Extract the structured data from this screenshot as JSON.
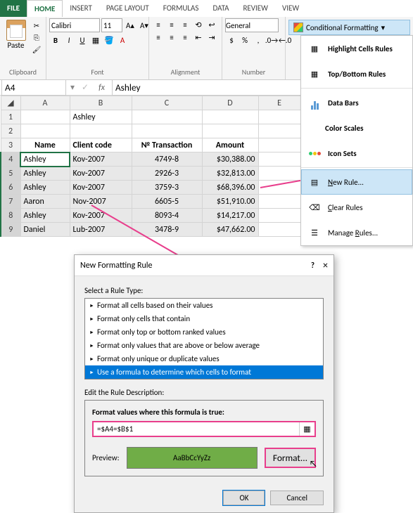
{
  "tabs": {
    "file": "FILE",
    "home": "HOME",
    "insert": "INSERT",
    "page_layout": "PAGE LAYOUT",
    "formulas": "FORMULAS",
    "data": "DATA",
    "review": "REVIEW",
    "view": "VIEW"
  },
  "ribbon": {
    "clipboard": {
      "paste": "Paste",
      "label": "Clipboard"
    },
    "font": {
      "name": "Calibri",
      "size": "11",
      "label": "Font",
      "bold": "B",
      "italic": "I",
      "underline": "U"
    },
    "alignment": {
      "label": "Alignment"
    },
    "number": {
      "format": "General",
      "label": "Number",
      "currency": "$",
      "percent": "%",
      "comma": ","
    },
    "cf_label": "Conditional Formatting"
  },
  "cf_menu": {
    "highlight": "Highlight Cells Rules",
    "topbottom": "Top/Bottom Rules",
    "databars": "Data Bars",
    "colorscales": "Color Scales",
    "iconsets": "Icon Sets",
    "newrule": "New Rule...",
    "clear": "Clear Rules",
    "manage": "Manage Rules...",
    "new_accel": "N",
    "clear_accel": "C",
    "manage_accel": "R"
  },
  "namebox": "A4",
  "fx": "fx",
  "formula_value": "Ashley",
  "columns": [
    "A",
    "B",
    "C",
    "D",
    "E"
  ],
  "row1": {
    "b": "Ashley"
  },
  "headers": {
    "a": "Name",
    "b": "Client code",
    "c": "№ Transaction",
    "d": "Amount"
  },
  "rows": [
    {
      "n": "4",
      "a": "Ashley",
      "b": "Kov-2007",
      "c": "4749-8",
      "d": "$30,388.00"
    },
    {
      "n": "5",
      "a": "Ashley",
      "b": "Kov-2007",
      "c": "2926-3",
      "d": "$32,813.00"
    },
    {
      "n": "6",
      "a": "Ashley",
      "b": "Kov-2007",
      "c": "3759-3",
      "d": "$68,396.00"
    },
    {
      "n": "7",
      "a": "Aaron",
      "b": "Nov-2007",
      "c": "6605-5",
      "d": "$51,910.00"
    },
    {
      "n": "8",
      "a": "Ashley",
      "b": "Kov-2007",
      "c": "8093-4",
      "d": "$14,217.00"
    },
    {
      "n": "9",
      "a": "Daniel",
      "b": "Lub-2007",
      "c": "3478-9",
      "d": "$47,662.00"
    }
  ],
  "dialog": {
    "title": "New Formatting Rule",
    "help": "?",
    "close": "×",
    "select_label": "Select a Rule Type:",
    "rules": [
      "Format all cells based on their values",
      "Format only cells that contain",
      "Format only top or bottom ranked values",
      "Format only values that are above or below average",
      "Format only unique or duplicate values",
      "Use a formula to determine which cells to format"
    ],
    "edit_label": "Edit the Rule Description:",
    "formula_label": "Format values where this formula is true:",
    "formula": "=$A4=$B$1",
    "preview_label": "Preview:",
    "preview_text": "AaBbCcYyZz",
    "format_btn": "Format...",
    "ok": "OK",
    "cancel": "Cancel"
  }
}
